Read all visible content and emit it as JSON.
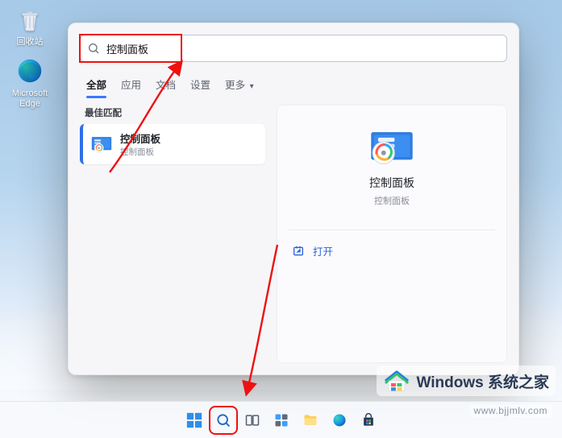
{
  "desktop": {
    "recycle_label": "回收站",
    "edge_label": "Microsoft Edge"
  },
  "search": {
    "query": "控制面板",
    "placeholder": ""
  },
  "tabs": {
    "all": "全部",
    "apps": "应用",
    "docs": "文档",
    "settings": "设置",
    "more": "更多"
  },
  "left": {
    "best_match": "最佳匹配",
    "result_title": "控制面板",
    "result_sub": "控制面板"
  },
  "detail": {
    "title": "控制面板",
    "sub": "控制面板",
    "open": "打开"
  },
  "watermark": {
    "brand": "Windows 系统之家",
    "url": "www.bjjmlv.com"
  }
}
